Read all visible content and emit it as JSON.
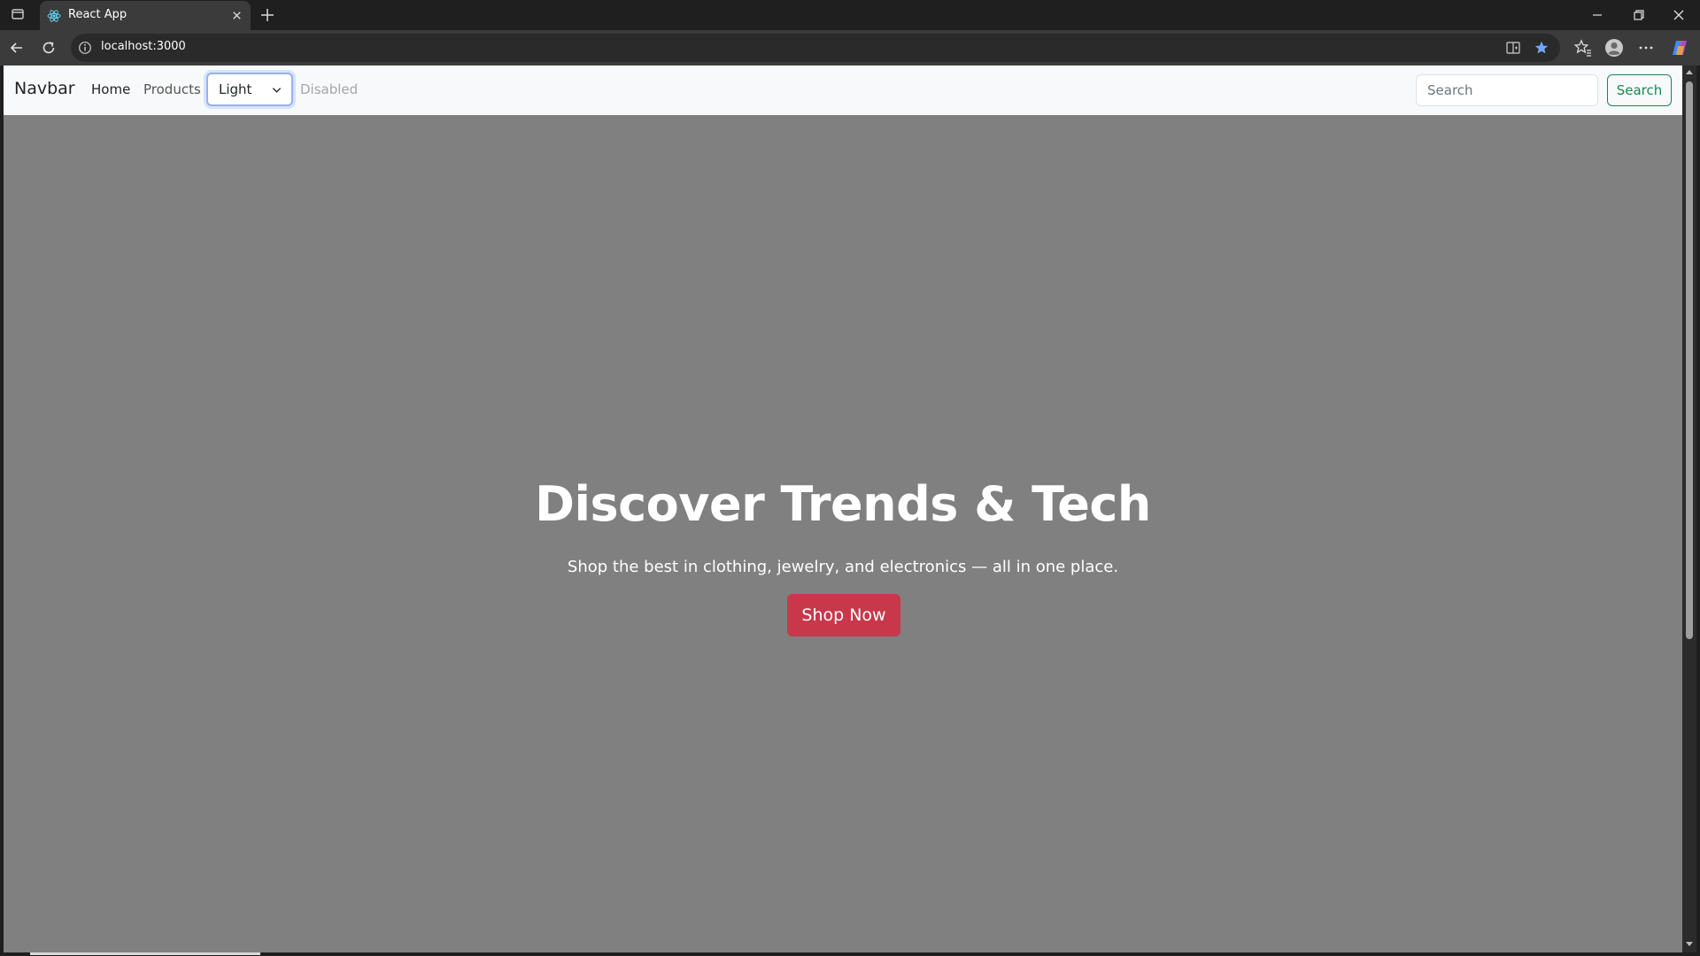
{
  "browser": {
    "tab_title": "React App",
    "url": "localhost:3000",
    "icons": {
      "tab_actions": "tab-actions-icon",
      "favicon": "react-icon",
      "tab_close": "close-icon",
      "new_tab": "plus-icon",
      "minimize": "minimize-icon",
      "restore": "restore-icon",
      "close_window": "close-icon",
      "back": "back-arrow-icon",
      "reload": "reload-icon",
      "site_info": "info-icon",
      "split_screen": "split-screen-icon",
      "favorite": "star-icon",
      "favorites": "favorites-icon",
      "profile": "profile-icon",
      "more": "more-icon",
      "copilot": "copilot-icon"
    }
  },
  "navbar": {
    "brand": "Navbar",
    "links": {
      "home": "Home",
      "products": "Products",
      "disabled": "Disabled"
    },
    "theme_select": {
      "value": "Light"
    },
    "search": {
      "placeholder": "Search",
      "button": "Search"
    }
  },
  "hero": {
    "title": "Discover Trends & Tech",
    "subtitle": "Shop the best in clothing, jewelry, and electronics — all in one place.",
    "cta": "Shop Now"
  },
  "colors": {
    "hero_bg": "#808080",
    "cta_bg": "#c8384a",
    "search_button": "#198754",
    "select_focus": "#9aaef7",
    "navbar_bg": "#f8f9fa"
  }
}
